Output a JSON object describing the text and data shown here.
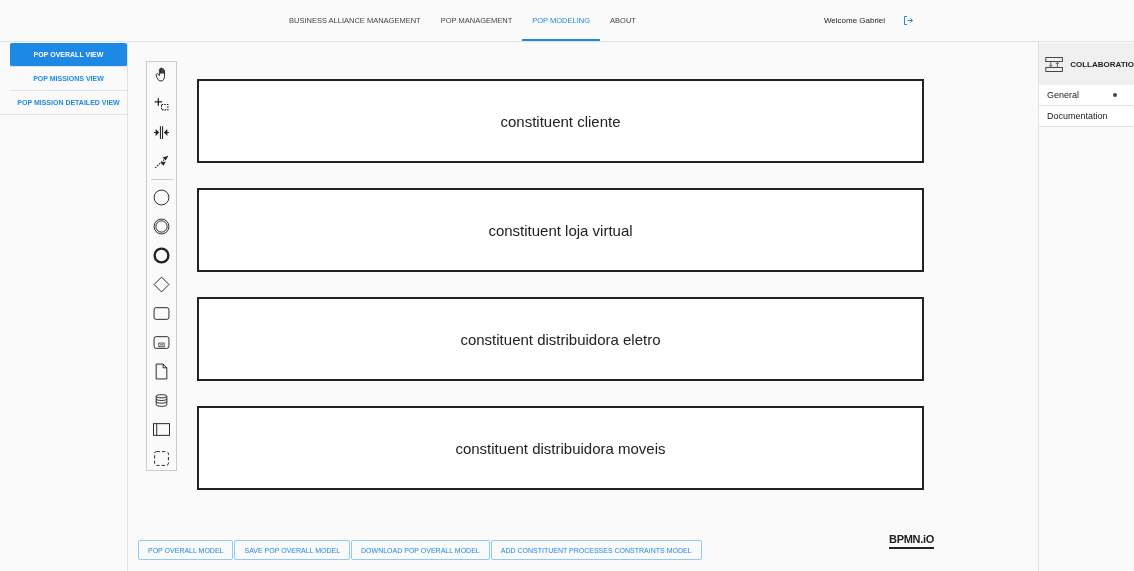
{
  "nav": {
    "tabs": [
      {
        "label": "BUSINESS ALLIANCE MANAGEMENT",
        "selected": false
      },
      {
        "label": "POP MANAGEMENT",
        "selected": false
      },
      {
        "label": "POP MODELING",
        "selected": true
      },
      {
        "label": "ABOUT",
        "selected": false
      }
    ],
    "welcome": "Welcome Gabriel"
  },
  "sidebar": {
    "items": [
      {
        "label": "POP OVERALL VIEW",
        "selected": true
      },
      {
        "label": "POP MISSIONS VIEW",
        "selected": false
      },
      {
        "label": "POP MISSION DETAILED VIEW",
        "selected": false
      }
    ]
  },
  "pools": [
    {
      "label": "constituent cliente"
    },
    {
      "label": "constituent loja virtual"
    },
    {
      "label": "constituent distribuidora eletro"
    },
    {
      "label": "constituent distribuidora moveis"
    }
  ],
  "properties": {
    "title": "COLLABORATIO",
    "tabs": [
      {
        "label": "General",
        "marked": true
      },
      {
        "label": "Documentation",
        "marked": false
      }
    ]
  },
  "buttons": [
    "POP OVERALL MODEL",
    "SAVE POP OVERALL MODEL",
    "DOWNLOAD POP OVERALL MODEL",
    "ADD CONSTITUENT PROCESSES CONSTRAINTS MODEL"
  ],
  "logo": "BPMN.iO"
}
